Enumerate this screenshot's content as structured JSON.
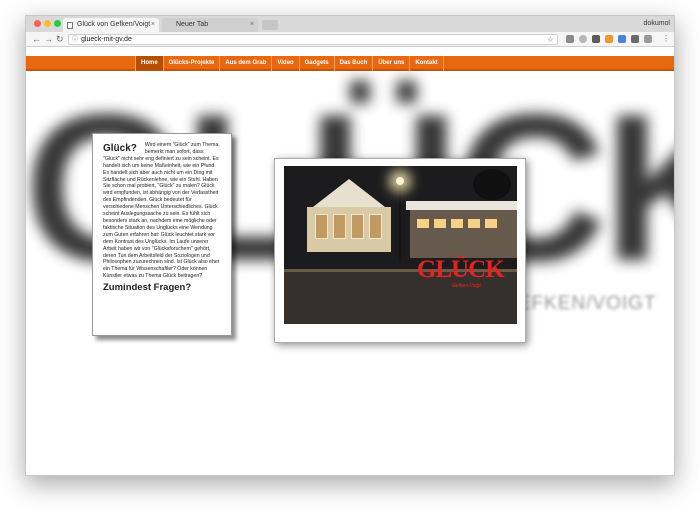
{
  "browser": {
    "tabs": [
      {
        "title": "Glück von Gefken/Voigt",
        "active": true
      },
      {
        "title": "Neuer Tab",
        "active": false
      }
    ],
    "user": "dokumol",
    "url": "glueck-mit-gv.de",
    "nav_icons": [
      "back-icon",
      "forward-icon",
      "reload-icon"
    ],
    "close_symbol": "×"
  },
  "site": {
    "menu": [
      "Home",
      "Glücks-Projekte",
      "Aus dem Grab",
      "Video",
      "Gadgets",
      "Das Buch",
      "Über uns",
      "Kontakt"
    ],
    "background_logo": "GLÜCK",
    "background_subtitle": "GEFKEN/VOIGT",
    "card": {
      "title": "Glück?",
      "body": "Wird einem \"Glück\" zum Thema, bemerkt man sofort, dass \"Glück\" nicht sehr eng definiert zu sein scheint. Es handelt sich um keine Maßeinheit, wie ein Pfund. Es handelt sich aber auch nicht um ein Ding mit Sitzfläche und Rückenlehne, wie ein Stuhl. Haben Sie schon mal probiert, \"Glück\" zu malen? Glück wird empfunden, ist abhängig von der Verfasstheit des Empfindenden. Glück bedeutet für verschiedene Menschen Unterschiedliches. Glück scheint Auslegungssache zu sein. Es fühlt sich besonders stark an, nachdem eine mögliche oder faktische Situation des Unglücks eine Wendung zum Guten erfahren hat: Glück leuchtet stark vor dem Kontrast des Unglücks. Im Laufe unserer Arbeit haben wir von \"Glücksforschern\" gehört, deren Tun dem Arbeitsfeld der Soziologen und Philosophen zuzurechnen sind. Ist Glück also eher ein Thema für Wissenschaftler? Oder können Künstler etwas zu Thema Glück beitragen?",
      "footer": "Zumindest Fragen?"
    },
    "photo": {
      "logo_text": "GLÜCK",
      "logo_subtext": "Gefken/Voigt"
    }
  },
  "colors": {
    "menu_bar": "#e8680f",
    "accent_red": "#e52422"
  }
}
